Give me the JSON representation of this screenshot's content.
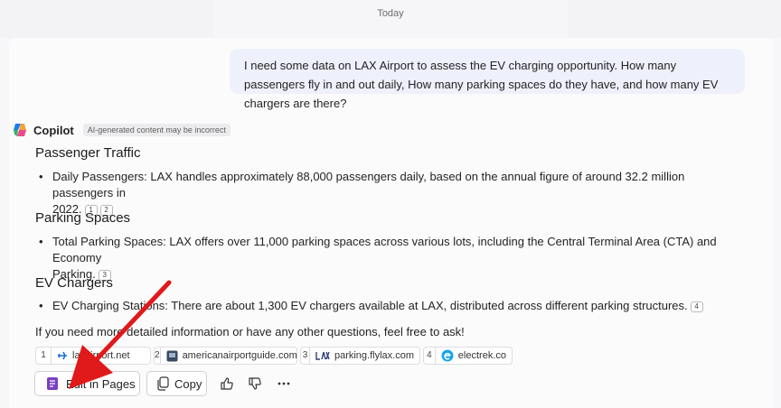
{
  "header": {
    "date_label": "Today"
  },
  "user_message": "I need some data on LAX Airport to assess the EV charging opportunity. How many passengers fly in and out daily, How many parking spaces do they have, and how many EV chargers are there?",
  "copilot": {
    "name": "Copilot",
    "badge": "AI-generated content may be incorrect",
    "sections": [
      {
        "heading": "Passenger Traffic",
        "bullet": "Daily Passengers: LAX handles approximately 88,000 passengers daily, based on the annual figure of around 32.2 million passengers in",
        "bullet_cont": "2022.",
        "citations": [
          "1",
          "2"
        ]
      },
      {
        "heading": "Parking Spaces",
        "bullet": "Total Parking Spaces: LAX offers over 11,000 parking spaces across various lots, including the Central Terminal Area (CTA) and Economy",
        "bullet_cont": "Parking.",
        "citations": [
          "3"
        ]
      },
      {
        "heading": "EV Chargers",
        "bullet": "EV Charging Stations: There are about 1,300 EV chargers available at LAX, distributed across different parking structures.",
        "citations": [
          "4"
        ]
      }
    ],
    "outro": "If you need more detailed information or have any other questions, feel free to ask!",
    "sources": [
      {
        "num": "1",
        "name": "laxairport.net",
        "icon": "airplane-icon"
      },
      {
        "num": "2",
        "name": "americanairportguide.com",
        "icon": "site-thumbnail-icon"
      },
      {
        "num": "3",
        "name": "parking.flylax.com",
        "icon": "lax-logo-icon"
      },
      {
        "num": "4",
        "name": "electrek.co",
        "icon": "electrek-e-icon"
      }
    ],
    "actions": {
      "edit_in_pages": "Edit in Pages",
      "copy": "Copy"
    }
  },
  "colors": {
    "annotation_arrow": "#e0191b",
    "pages_icon": "#7b3fbf",
    "user_bubble": "#eef0fb"
  }
}
